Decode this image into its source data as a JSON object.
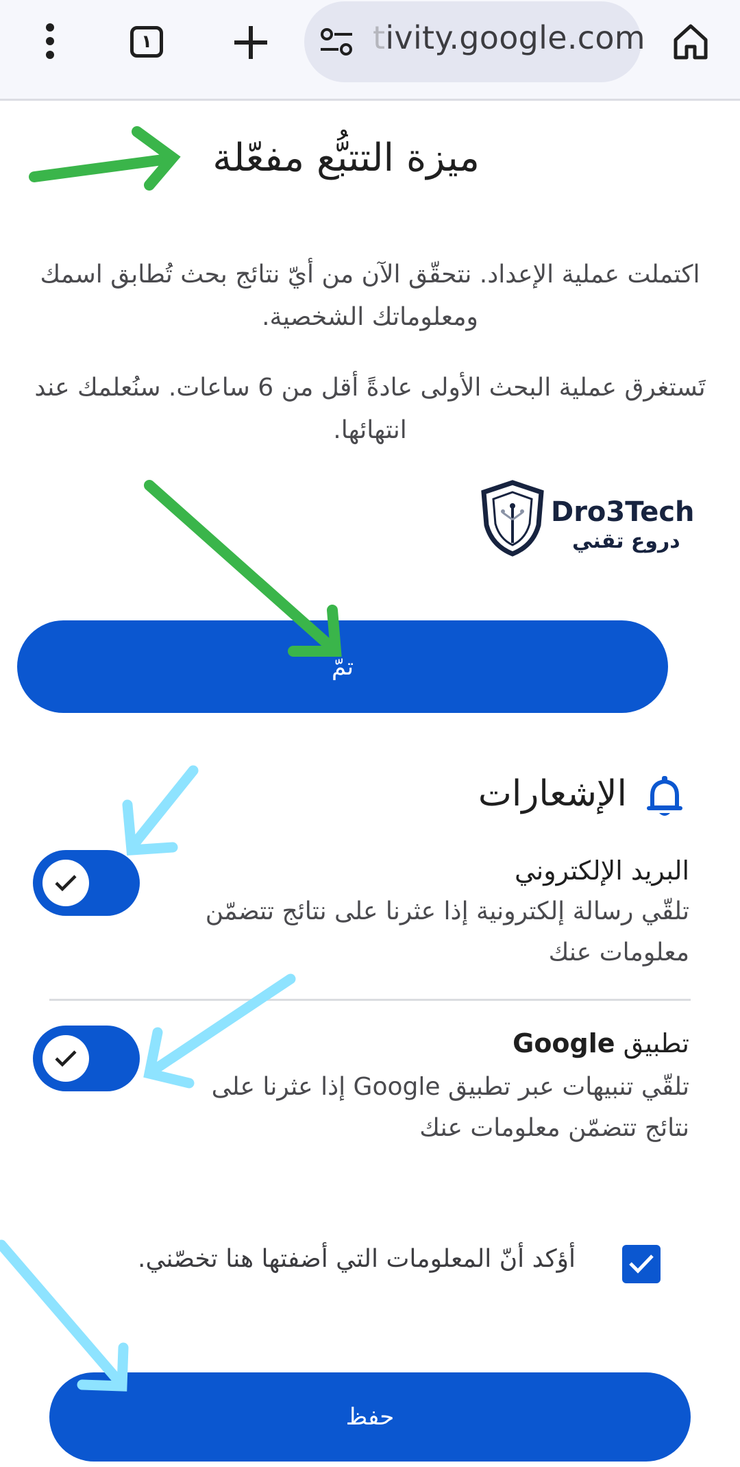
{
  "browser": {
    "tab_count": "١",
    "url_fade": "t",
    "url": "ivity.google.com",
    "icons": {
      "menu": "more-vert-icon",
      "tabs": "tab-switcher-icon",
      "new_tab": "plus-icon",
      "site_settings": "tune-icon",
      "home": "home-icon"
    }
  },
  "page": {
    "heading": "ميزة التتبُّع مفعّلة",
    "paragraph_1": "اكتملت عملية الإعداد. نتحقّق الآن من أيّ نتائج بحث تُطابق اسمك ومعلوماتك الشخصية.",
    "paragraph_2": "تَستغرق عملية البحث الأولى عادةً أقل من 6 ساعات. سنُعلمك عند انتهائها.",
    "logo": {
      "name": "Dro3Tech",
      "subtitle": "دروع تقني"
    },
    "done_button": "تمّ"
  },
  "notifications": {
    "title": "الإشعارات",
    "icon": "bell-icon",
    "email": {
      "title": "البريد الإلكتروني",
      "description": "تلقّي رسالة إلكترونية إذا عثرنا على نتائج تتضمّن معلومات عنك",
      "enabled": true
    },
    "app": {
      "title_prefix": "تطبيق",
      "title_brand": "Google",
      "description": "تلقّي تنبيهات عبر تطبيق Google إذا عثرنا على نتائج تتضمّن معلومات عنك",
      "enabled": true
    }
  },
  "confirm": {
    "label": "أؤكد أنّ المعلومات التي أضفتها هنا تخصّني.",
    "checked": true
  },
  "save_button": "حفظ",
  "colors": {
    "primary": "#0b57d0",
    "annotation_green": "#3ab54a",
    "annotation_cyan": "#8ee3ff"
  }
}
